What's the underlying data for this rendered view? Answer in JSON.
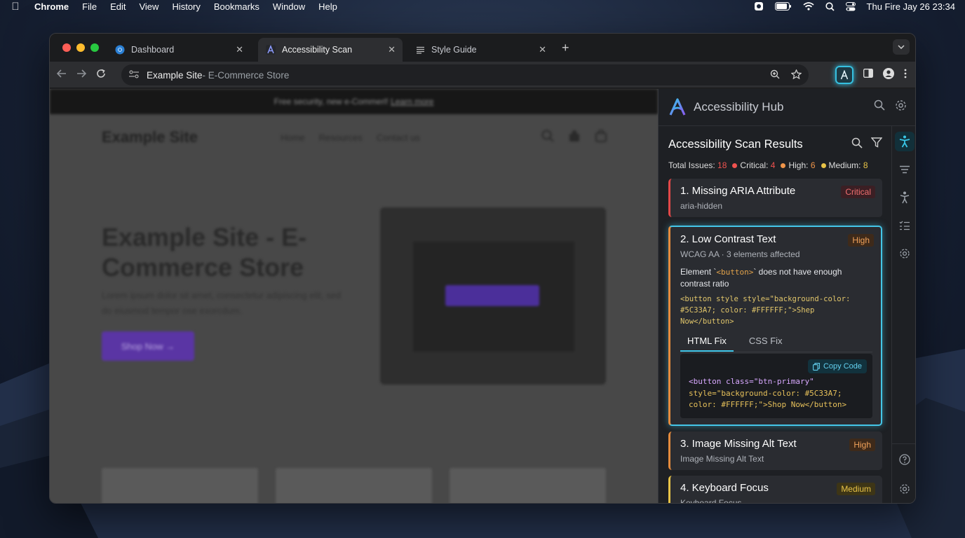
{
  "menubar": {
    "app": "Chrome",
    "menus": [
      "File",
      "Edit",
      "View",
      "History",
      "Bookmarks",
      "Window",
      "Help"
    ],
    "clock": "Thu Fire Jay 26  23:34"
  },
  "tabs": [
    {
      "label": "Dashboard",
      "icon": "chrome-icon"
    },
    {
      "label": "Accessibility Scan",
      "icon": "accessibility-hub-icon"
    },
    {
      "label": "Style Guide",
      "icon": "document-icon"
    }
  ],
  "omnibox": {
    "site": "Example Site",
    "subtitle": " - E-Commerce Store"
  },
  "page": {
    "promo_text": "Free security, new e-Commerl!",
    "promo_link": "Learn more",
    "logo": "Example Site",
    "nav": [
      "Home",
      "Resources",
      "Contact us"
    ],
    "hero_title": "Example Site - E-Commerce Store",
    "hero_text": "Lorem ipsum dolor sit amet, consectetur adipiscing elit, sed do eiusmod tempor ose exorcdum.",
    "hero_button": "Shop Now →"
  },
  "panel": {
    "title": "Accessibility Hub",
    "results_title": "Accessibility Scan Results",
    "summary": {
      "total_label": "Total Issues:",
      "total": "18",
      "critical_label": "Critical:",
      "critical": "4",
      "high_label": "High:",
      "high": "6",
      "medium_label": "Medium:",
      "medium": "8"
    },
    "issues": [
      {
        "title": "1. Missing ARIA Attribute",
        "sub": "aria-hidden",
        "badge": "Critical"
      },
      {
        "title": "2. Low Contrast Text",
        "sub": "WCAG AA · 3 elements affected",
        "badge": "High",
        "desc_pre": "Element `",
        "desc_tag": "<button>",
        "desc_post": "` does not have enough contrast ratio",
        "snippet_line1": "<button style style=\"background-color:",
        "snippet_line2": "#5C33A7; color: #FFFFFF;\">Shep Now</button>",
        "tab_html": "HTML Fix",
        "tab_css": "CSS Fix",
        "copy_label": "Copy Code",
        "fix_line1": "<button class=\"btn-primary\"",
        "fix_line2": "style=\"background-color: #5C33A7;",
        "fix_line3": "color: #FFFFFF;\">Shop Now</button>"
      },
      {
        "title": "3. Image Missing Alt Text",
        "sub": "Image Missing Alt Text",
        "badge": "High"
      },
      {
        "title": "4. Keyboard Focus",
        "sub": "Keyboard Focus",
        "badge": "Medium"
      }
    ]
  },
  "colors": {
    "critical": "#f0524f",
    "high": "#f0954a",
    "medium": "#e8c347",
    "accent": "#3dc3e6"
  }
}
